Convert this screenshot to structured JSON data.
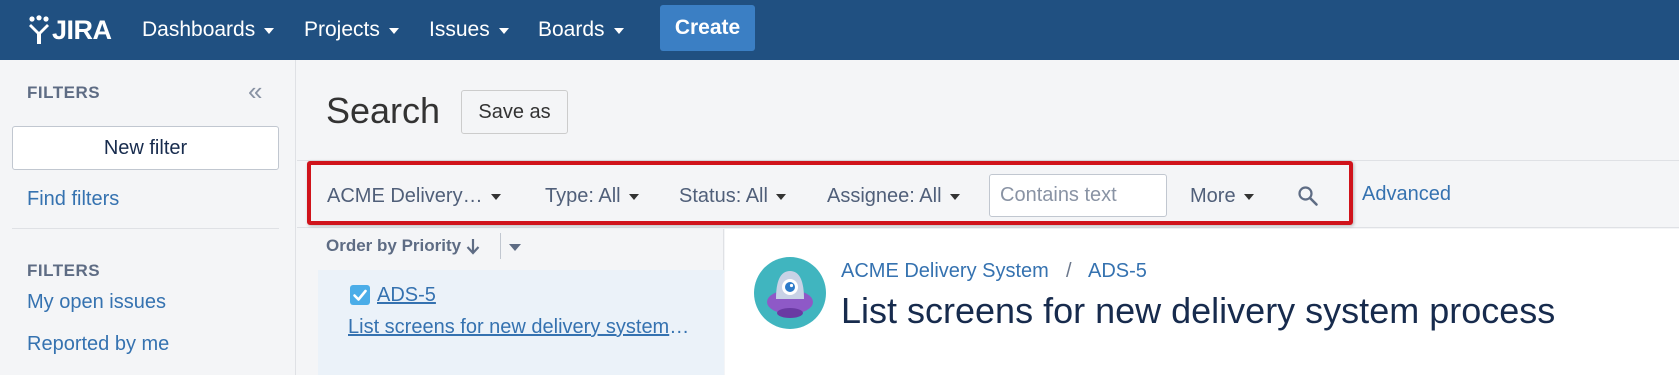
{
  "nav": {
    "logo_text": "JIRA",
    "items": [
      {
        "label": "Dashboards"
      },
      {
        "label": "Projects"
      },
      {
        "label": "Issues"
      },
      {
        "label": "Boards"
      }
    ],
    "create_label": "Create"
  },
  "sidebar": {
    "heading_top": "FILTERS",
    "new_filter_label": "New filter",
    "find_filters_label": "Find filters",
    "heading_filters": "FILTERS",
    "filters": [
      {
        "label": "My open issues"
      },
      {
        "label": "Reported by me"
      }
    ]
  },
  "search": {
    "title": "Search",
    "save_as_label": "Save as",
    "criteria": {
      "project": "ACME Delivery…",
      "type": "Type: All",
      "status": "Status: All",
      "assignee": "Assignee: All",
      "more": "More"
    },
    "text_placeholder": "Contains text",
    "advanced_label": "Advanced"
  },
  "results": {
    "order_by_label": "Order by Priority",
    "issues": [
      {
        "key": "ADS-5",
        "summary": "List screens for new delivery system process"
      }
    ]
  },
  "detail": {
    "project_name": "ACME Delivery System",
    "separator": "/",
    "issue_key": "ADS-5",
    "title": "List screens for new delivery system process"
  },
  "colors": {
    "nav_bg": "#205081",
    "create_bg": "#3b7fc4",
    "link": "#3572b0",
    "highlight_border": "#d0131b"
  }
}
